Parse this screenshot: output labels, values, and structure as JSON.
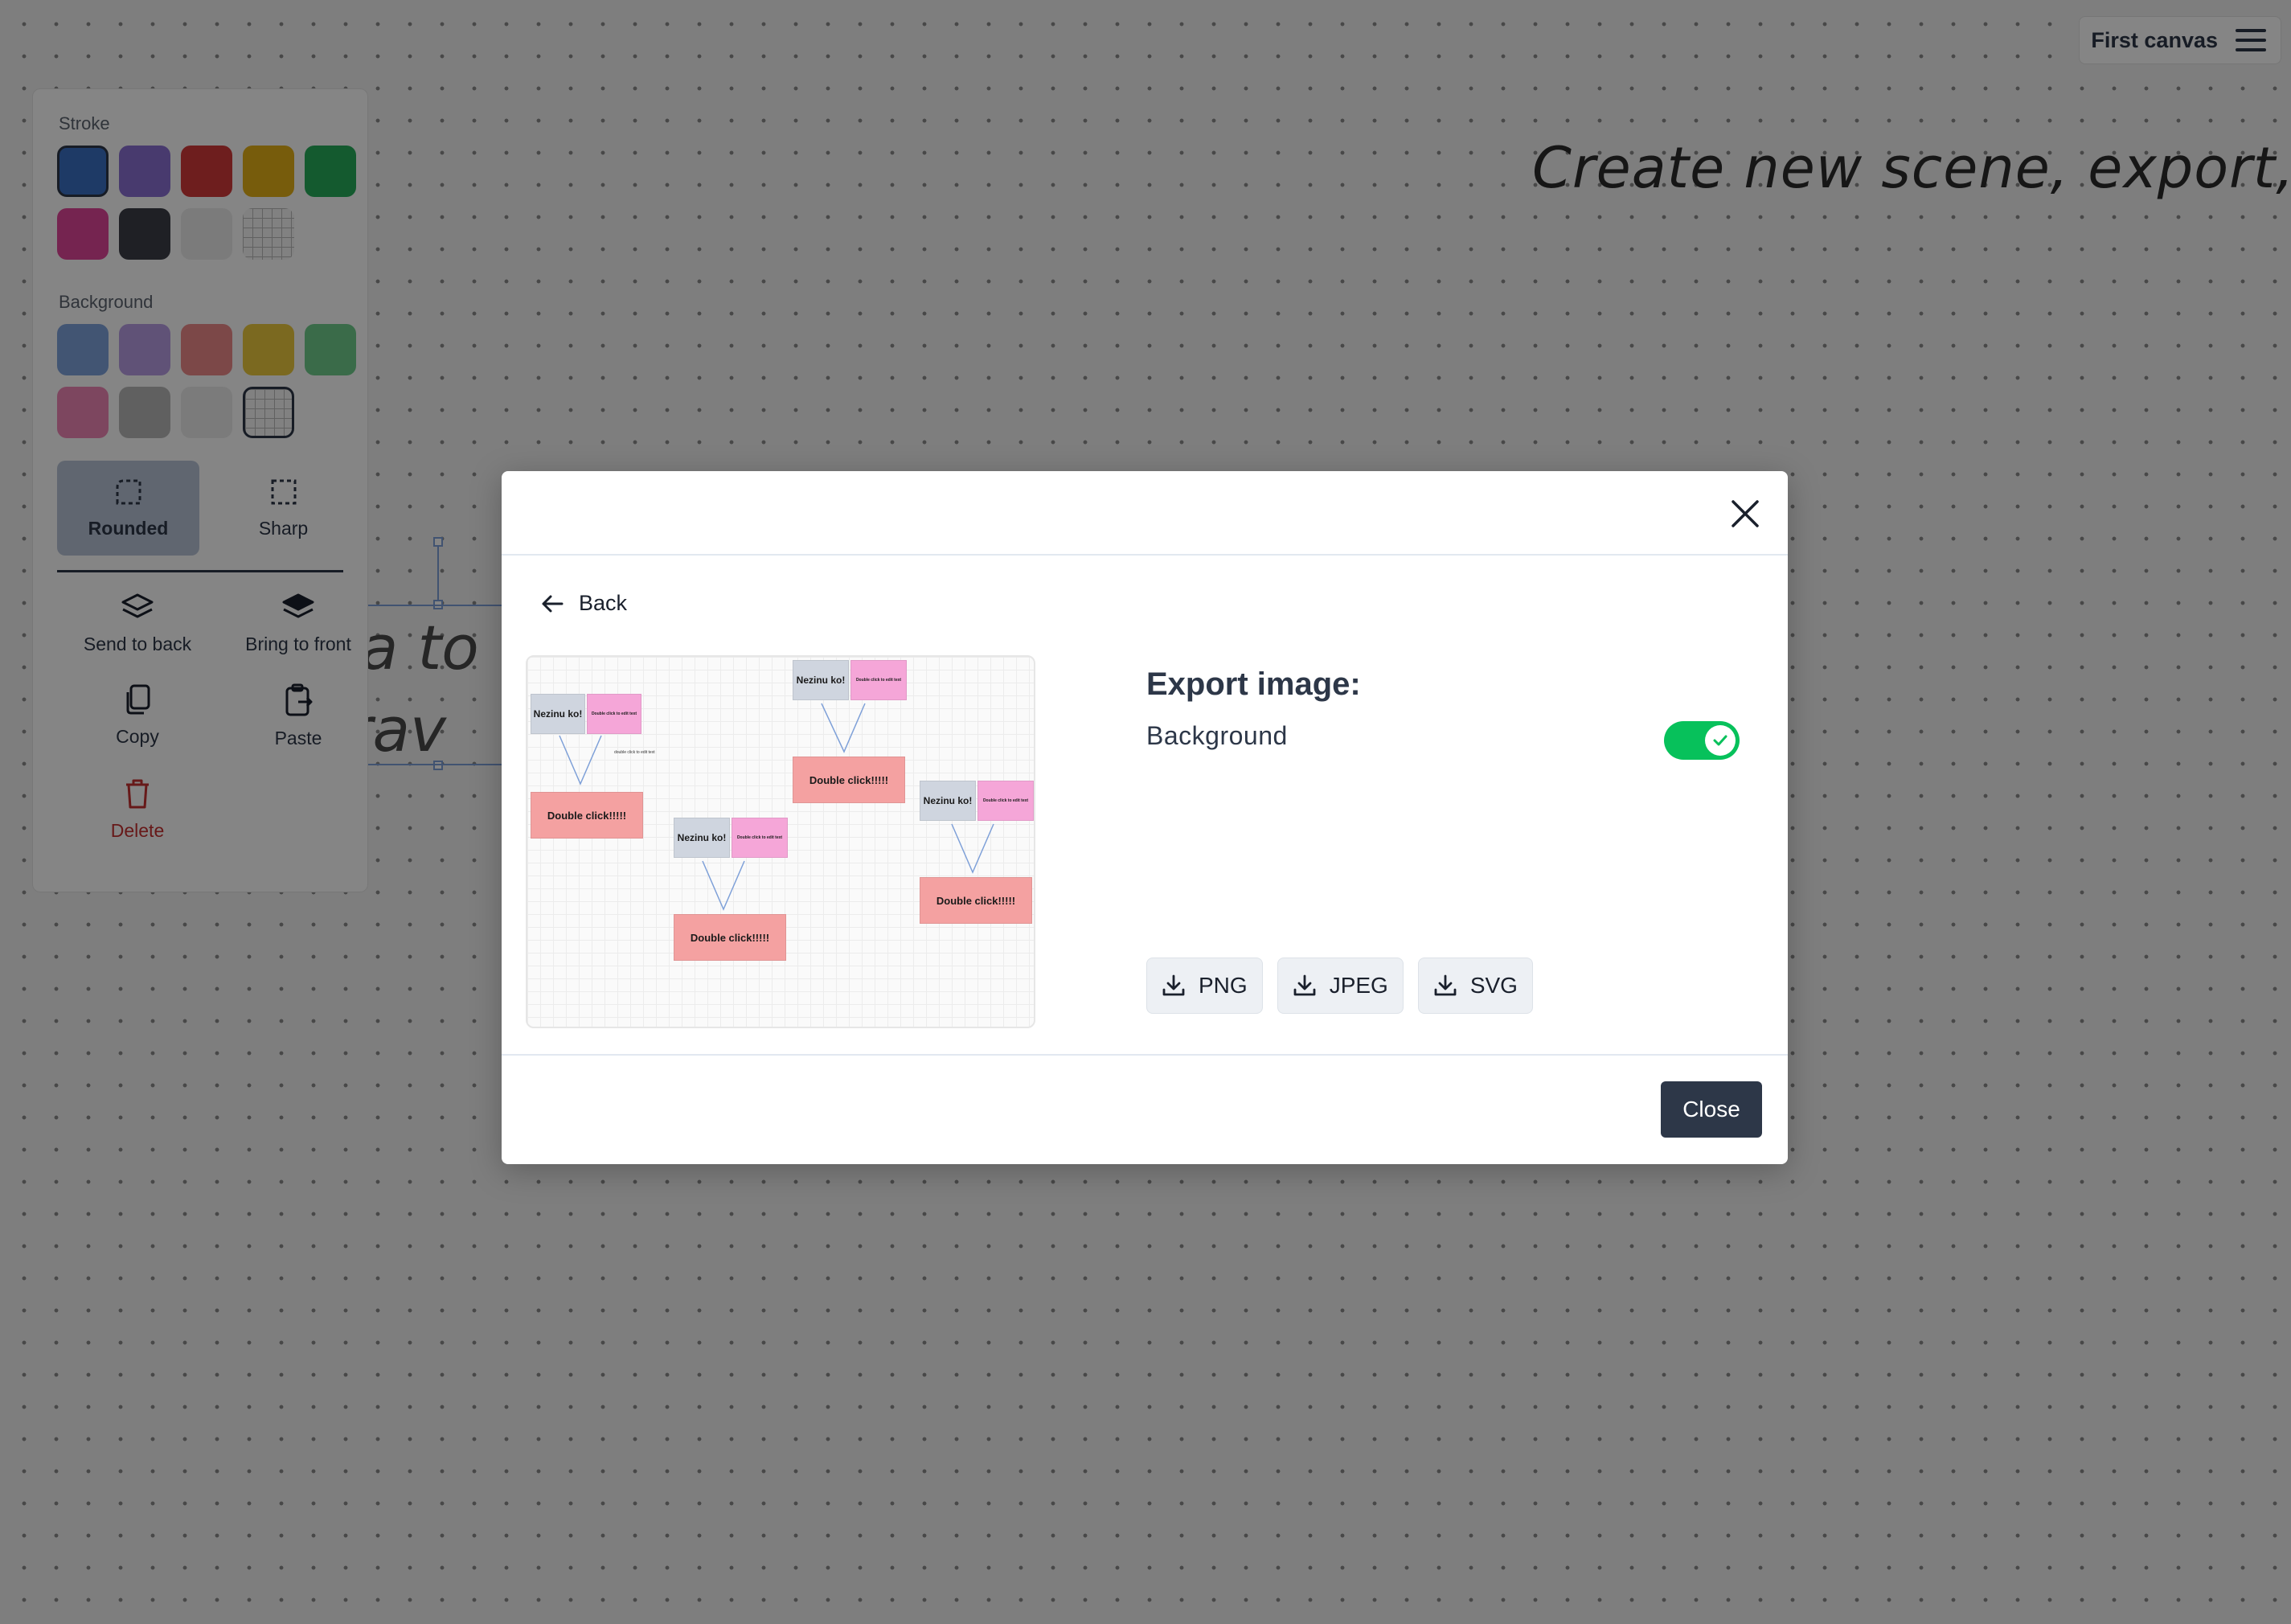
{
  "canvas": {
    "title_text": "Create new scene, export, ...",
    "note_line1": "Rc a to",
    "note_line2": "t drav"
  },
  "topbar": {
    "canvas_name": "First canvas"
  },
  "panel": {
    "stroke_label": "Stroke",
    "background_label": "Background",
    "stroke_colors": [
      "#3a6fc4",
      "#8a6fd3",
      "#d43a3a",
      "#e5b018",
      "#27ad5a",
      "#e0459a",
      "#3c3f47",
      "#ececec",
      "grid"
    ],
    "background_colors": [
      "#7fa3dc",
      "#b89de4",
      "#ee8a8a",
      "#ebca3f",
      "#6fce8c",
      "#ef86b6",
      "#b9b9b9",
      "#ececec",
      "grid"
    ],
    "rounded_label": "Rounded",
    "sharp_label": "Sharp",
    "send_to_back_label": "Send to back",
    "bring_to_front_label": "Bring to front",
    "copy_label": "Copy",
    "paste_label": "Paste",
    "delete_label": "Delete"
  },
  "dialog": {
    "back_label": "Back",
    "export_title": "Export image:",
    "background_label": "Background",
    "background_enabled": true,
    "png_label": "PNG",
    "jpeg_label": "JPEG",
    "svg_label": "SVG",
    "close_label": "Close",
    "preview": {
      "node_gray": "Nezinu ko!",
      "node_pink": "Double click to edit text",
      "node_red": "Double click!!!!!",
      "tiny_text": "double click to edit text"
    }
  },
  "colors": {
    "accent_toggle": "#07c15b",
    "button_dark": "#2d3748",
    "danger": "#c53030"
  }
}
